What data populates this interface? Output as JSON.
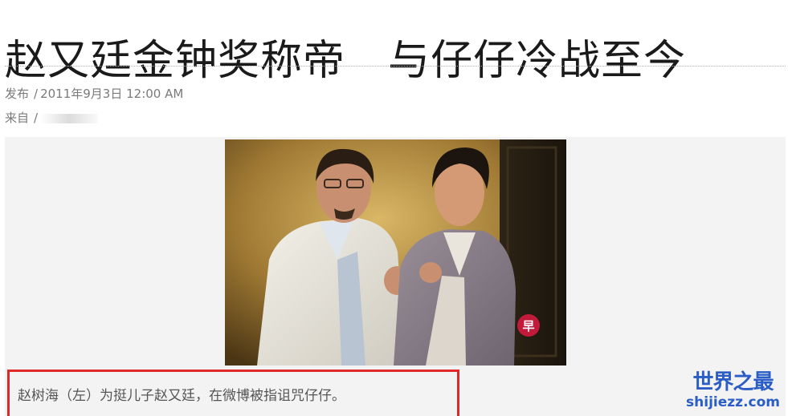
{
  "article": {
    "title": "赵又廷金钟奖称帝　与仔仔冷战至今",
    "published_label": "发布",
    "published_value": "2011年9月3日 12:00 AM",
    "source_label": "来自",
    "separator": "/"
  },
  "figure": {
    "photo_badge": "早",
    "caption": "赵树海（左）为挺儿子赵又廷，在微博被指诅咒仔仔。"
  },
  "watermark": {
    "name": "世界之最",
    "url": "shijiezz.com"
  },
  "colors": {
    "caption_highlight": "#e02a2a",
    "watermark": "#2a5dc6",
    "badge": "#c21a3a"
  }
}
